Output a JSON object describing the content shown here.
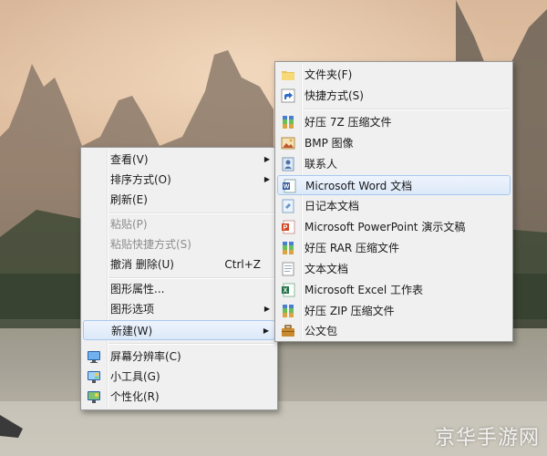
{
  "context_menu": {
    "items": [
      {
        "label": "查看(V)"
      },
      {
        "label": "排序方式(O)"
      },
      {
        "label": "刷新(E)"
      },
      {
        "label": "粘贴(P)"
      },
      {
        "label": "粘贴快捷方式(S)"
      },
      {
        "label": "撤消 删除(U)",
        "shortcut": "Ctrl+Z"
      },
      {
        "label": "图形属性..."
      },
      {
        "label": "图形选项"
      },
      {
        "label": "新建(W)"
      },
      {
        "label": "屏幕分辨率(C)"
      },
      {
        "label": "小工具(G)"
      },
      {
        "label": "个性化(R)"
      }
    ]
  },
  "new_submenu": {
    "items": [
      {
        "label": "文件夹(F)",
        "icon": "folder-icon"
      },
      {
        "label": "快捷方式(S)",
        "icon": "shortcut-icon"
      },
      {
        "label": "好压 7Z 压缩文件",
        "icon": "archive-icon"
      },
      {
        "label": "BMP 图像",
        "icon": "bmp-icon"
      },
      {
        "label": "联系人",
        "icon": "contact-icon"
      },
      {
        "label": "Microsoft Word 文档",
        "icon": "word-icon"
      },
      {
        "label": "日记本文档",
        "icon": "journal-icon"
      },
      {
        "label": "Microsoft PowerPoint 演示文稿",
        "icon": "powerpoint-icon"
      },
      {
        "label": "好压 RAR 压缩文件",
        "icon": "archive-icon"
      },
      {
        "label": "文本文档",
        "icon": "text-doc-icon"
      },
      {
        "label": "Microsoft Excel 工作表",
        "icon": "excel-icon"
      },
      {
        "label": "好压 ZIP 压缩文件",
        "icon": "archive-icon"
      },
      {
        "label": "公文包",
        "icon": "briefcase-icon"
      }
    ]
  },
  "watermark": "京华手游网"
}
